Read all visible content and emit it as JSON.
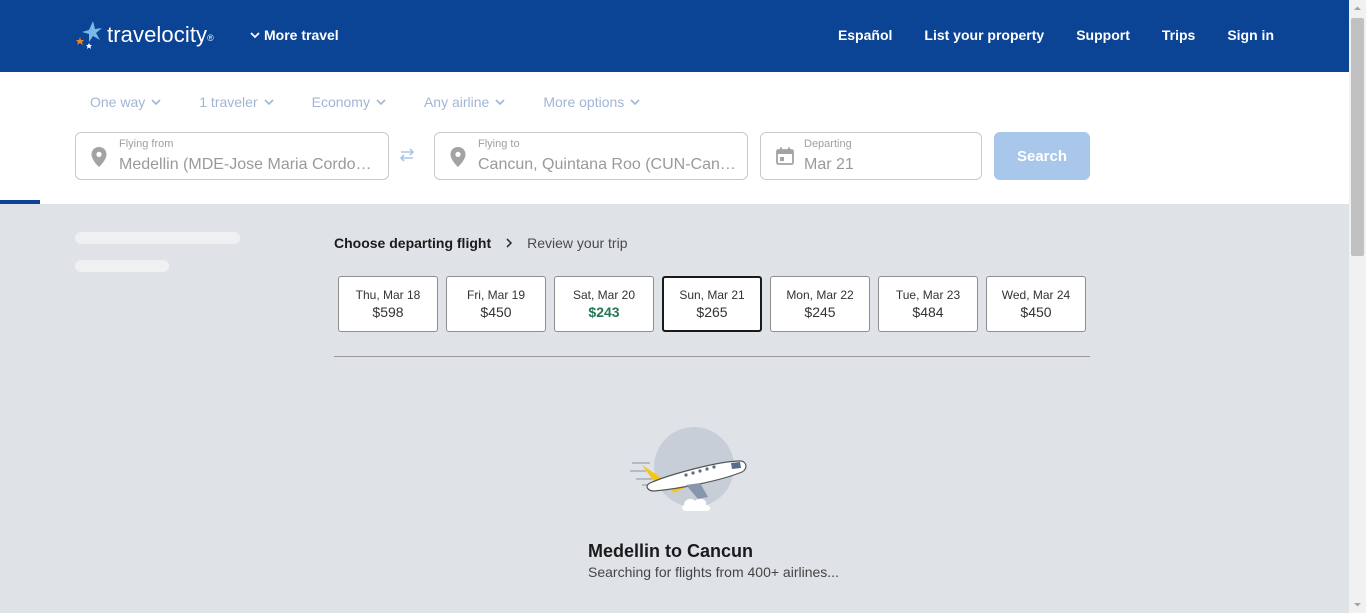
{
  "header": {
    "logo_text": "travelocity",
    "logo_tm": "®",
    "more_travel": "More travel",
    "nav": [
      "Español",
      "List your property",
      "Support",
      "Trips",
      "Sign in"
    ]
  },
  "filters": [
    "One way",
    "1 traveler",
    "Economy",
    "Any airline",
    "More options"
  ],
  "search": {
    "from_label": "Flying from",
    "from_value": "Medellin (MDE-Jose Maria Cordova Intl.)",
    "to_label": "Flying to",
    "to_value": "Cancun, Quintana Roo (CUN-Cancun Intl.)",
    "depart_label": "Departing",
    "depart_value": "Mar 21",
    "button": "Search"
  },
  "breadcrumb": {
    "active": "Choose departing flight",
    "next": "Review your trip"
  },
  "dates": [
    {
      "label": "Thu, Mar 18",
      "price": "$598"
    },
    {
      "label": "Fri, Mar 19",
      "price": "$450"
    },
    {
      "label": "Sat, Mar 20",
      "price": "$243"
    },
    {
      "label": "Sun, Mar 21",
      "price": "$265"
    },
    {
      "label": "Mon, Mar 22",
      "price": "$245"
    },
    {
      "label": "Tue, Mar 23",
      "price": "$484"
    },
    {
      "label": "Wed, Mar 24",
      "price": "$450"
    }
  ],
  "loading": {
    "title": "Medellin to Cancun",
    "subtitle": "Searching for flights from 400+ airlines..."
  },
  "colors": {
    "brand": "#0b4395",
    "cheapest": "#227950"
  }
}
